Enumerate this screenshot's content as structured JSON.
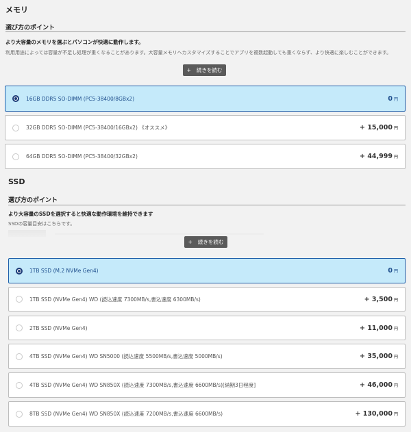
{
  "memory": {
    "heading": "メモリ",
    "point_title": "選び方のポイント",
    "lead": "より大容量のメモリを選ぶとパソコンが快適に動作します。",
    "body": "利用用途によっては容量が不足し処理が重くなることがあります。大容量メモリへカスタマイズすることでアプリを複数起動しても重くならず、より快適に楽しむことができます。",
    "more_button": "続きを読む",
    "more_icon": "+",
    "options": [
      {
        "label": "16GB DDR5 SO-DIMM (PC5-38400/8GBx2)",
        "price": "0",
        "unit": "円",
        "selected": true
      },
      {
        "label": "32GB DDR5 SO-DIMM (PC5-38400/16GBx2) 《オススメ》",
        "price": "+ 15,000",
        "unit": "円",
        "selected": false
      },
      {
        "label": "64GB DDR5 SO-DIMM (PC5-38400/32GBx2)",
        "price": "+ 44,999",
        "unit": "円",
        "selected": false
      }
    ]
  },
  "ssd": {
    "heading": "SSD",
    "point_title": "選び方のポイント",
    "lead": "より大容量のSSDを選択すると快適な動作環境を維持できます",
    "body": "SSDの容量目安はこちらです。",
    "more_button": "続きを読む",
    "more_icon": "+",
    "options": [
      {
        "label": "1TB SSD (M.2 NVMe Gen4)",
        "price": "0",
        "unit": "円",
        "selected": true
      },
      {
        "label": "1TB SSD (NVMe Gen4) WD (読込速度 7300MB/s,書込速度 6300MB/s)",
        "price": "+ 3,500",
        "unit": "円",
        "selected": false
      },
      {
        "label": "2TB SSD (NVMe Gen4)",
        "price": "+ 11,000",
        "unit": "円",
        "selected": false
      },
      {
        "label": "4TB SSD (NVMe Gen4) WD SN5000 (読込速度 5500MB/s,書込速度 5000MB/s)",
        "price": "+ 35,000",
        "unit": "円",
        "selected": false
      },
      {
        "label": "4TB SSD (NVMe Gen4) WD SN850X (読込速度 7300MB/s,書込速度 6600MB/s)[納期3日程度]",
        "price": "+ 46,000",
        "unit": "円",
        "selected": false
      },
      {
        "label": "8TB SSD (NVMe Gen4) WD SN850X (読込速度 7200MB/s,書込速度 6600MB/s)",
        "price": "+ 130,000",
        "unit": "円",
        "selected": false
      }
    ]
  }
}
